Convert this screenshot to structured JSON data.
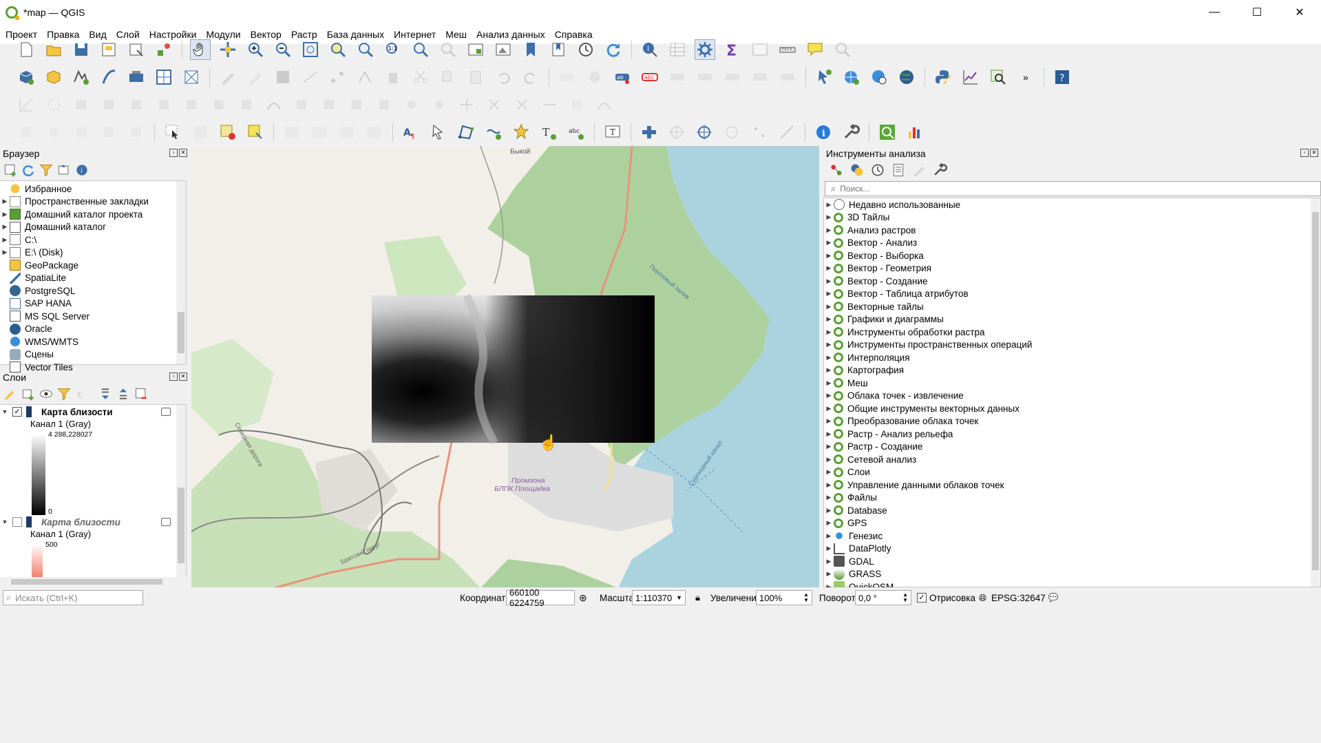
{
  "window": {
    "title": "*map — QGIS",
    "minimize": "—",
    "maximize": "☐",
    "close": "✕"
  },
  "menu": [
    "Проект",
    "Правка",
    "Вид",
    "Слой",
    "Настройки",
    "Модули",
    "Вектор",
    "Растр",
    "База данных",
    "Интернет",
    "Меш",
    "Анализ данных",
    "Справка"
  ],
  "browser": {
    "title": "Браузер",
    "items": [
      {
        "label": "Избранное",
        "icon": "star-icon"
      },
      {
        "label": "Пространственные закладки",
        "icon": "bookmark-icon"
      },
      {
        "label": "Домашний каталог проекта",
        "icon": "project-home-icon"
      },
      {
        "label": "Домашний каталог",
        "icon": "home-folder-icon"
      },
      {
        "label": "C:\\",
        "icon": "folder-icon"
      },
      {
        "label": "E:\\ (Disk)",
        "icon": "folder-icon"
      },
      {
        "label": "GeoPackage",
        "icon": "geopackage-icon"
      },
      {
        "label": "SpatiaLite",
        "icon": "spatialite-icon"
      },
      {
        "label": "PostgreSQL",
        "icon": "postgresql-icon"
      },
      {
        "label": "SAP HANA",
        "icon": "sap-hana-icon"
      },
      {
        "label": "MS SQL Server",
        "icon": "mssql-icon"
      },
      {
        "label": "Oracle",
        "icon": "oracle-icon"
      },
      {
        "label": "WMS/WMTS",
        "icon": "wms-icon"
      },
      {
        "label": "Сцены",
        "icon": "scenes-icon"
      },
      {
        "label": "Vector Tiles",
        "icon": "vector-tiles-icon"
      }
    ]
  },
  "layers": {
    "title": "Слои",
    "items": [
      {
        "name": "Карта близости",
        "band": "Канал 1 (Gray)",
        "max": "4 288,228027",
        "min": "0",
        "checked": true
      },
      {
        "name": "Карта близости",
        "band": "Канал 1 (Gray)",
        "max": "500",
        "checked": false
      }
    ]
  },
  "processing": {
    "title": "Инструменты анализа",
    "search_placeholder": "Поиск...",
    "items": [
      "Недавно использованные",
      "3D Тайлы",
      "Анализ растров",
      "Вектор - Анализ",
      "Вектор - Выборка",
      "Вектор - Геометрия",
      "Вектор - Создание",
      "Вектор - Таблица атрибутов",
      "Векторные тайлы",
      "Графики и диаграммы",
      "Инструменты обработки растра",
      "Инструменты пространственных операций",
      "Интерполяция",
      "Картография",
      "Меш",
      "Облака точек - извлечение",
      "Общие инструменты векторных данных",
      "Преобразование облака точек",
      "Растр - Анализ рельефа",
      "Растр - Создание",
      "Сетевой анализ",
      "Слои",
      "Управление данными облаков точек",
      "Файлы",
      "Database",
      "GPS",
      "Генезис",
      "DataPlotly",
      "GDAL",
      "GRASS",
      "QuickOSM"
    ]
  },
  "map_labels": {
    "bykov": "Быкой",
    "promzona": "Промзона",
    "promzona2": "БЛПК Площадка",
    "rail": "Северная дорога",
    "bratsk": "Братский округ",
    "bay": "Пороговый залив",
    "channel": "Судоходный канал"
  },
  "statusbar": {
    "search_placeholder": "Искать (Ctrl+K)",
    "coords_label": "Координаты",
    "coords_value": "660100 6224759",
    "scale_label": "Масштаб",
    "scale_value": "1:110370",
    "zoom_label": "Увеличение",
    "zoom_value": "100%",
    "rotation_label": "Поворот",
    "rotation_value": "0,0 °",
    "render_label": "Отрисовка",
    "crs": "EPSG:32647"
  }
}
